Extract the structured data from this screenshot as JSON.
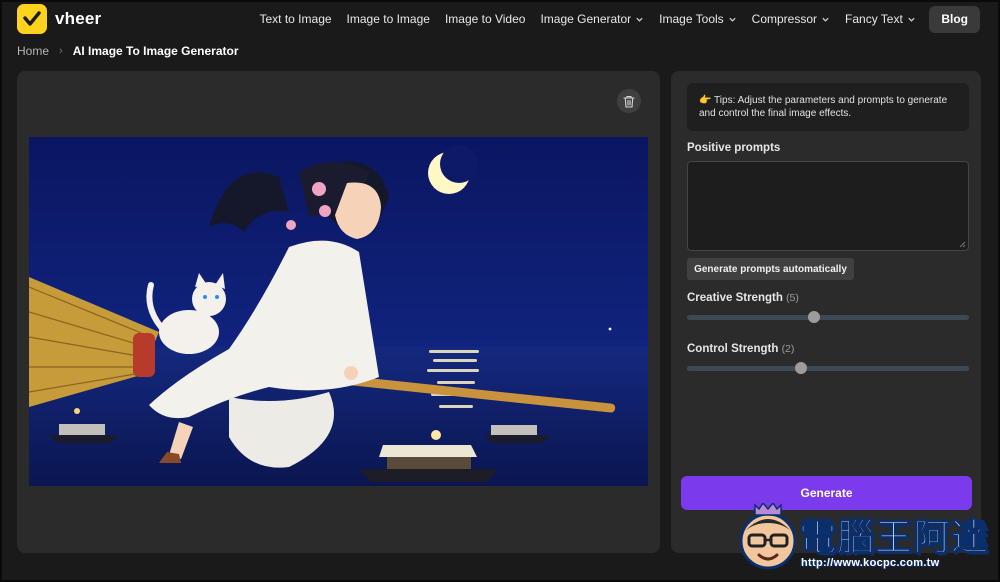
{
  "brand": {
    "name": "vheer",
    "accent": "#ffd21e"
  },
  "nav": {
    "items": [
      {
        "label": "Text to Image",
        "dropdown": false
      },
      {
        "label": "Image to Image",
        "dropdown": false
      },
      {
        "label": "Image to Video",
        "dropdown": false
      },
      {
        "label": "Image Generator",
        "dropdown": true
      },
      {
        "label": "Image Tools",
        "dropdown": true
      },
      {
        "label": "Compressor",
        "dropdown": true
      },
      {
        "label": "Fancy Text",
        "dropdown": true
      }
    ],
    "blog_label": "Blog"
  },
  "breadcrumb": {
    "home": "Home",
    "separator": "›",
    "current": "AI Image To Image Generator"
  },
  "canvas": {
    "delete_icon": "trash-icon"
  },
  "panel": {
    "tips": "👉 Tips: Adjust the parameters and prompts to generate and control the final image effects.",
    "positive_prompts_label": "Positive prompts",
    "positive_prompts_value": "",
    "generate_prompts_label": "Generate prompts automatically",
    "creative_strength": {
      "label": "Creative Strength",
      "value_text": "(5)",
      "fraction": 0.45
    },
    "control_strength": {
      "label": "Control Strength",
      "value_text": "(2)",
      "fraction": 0.405
    },
    "generate_label": "Generate",
    "generate_color": "#7c3aed"
  },
  "watermark": {
    "text": "電腦王阿達",
    "url": "http://www.kocpc.com.tw"
  }
}
